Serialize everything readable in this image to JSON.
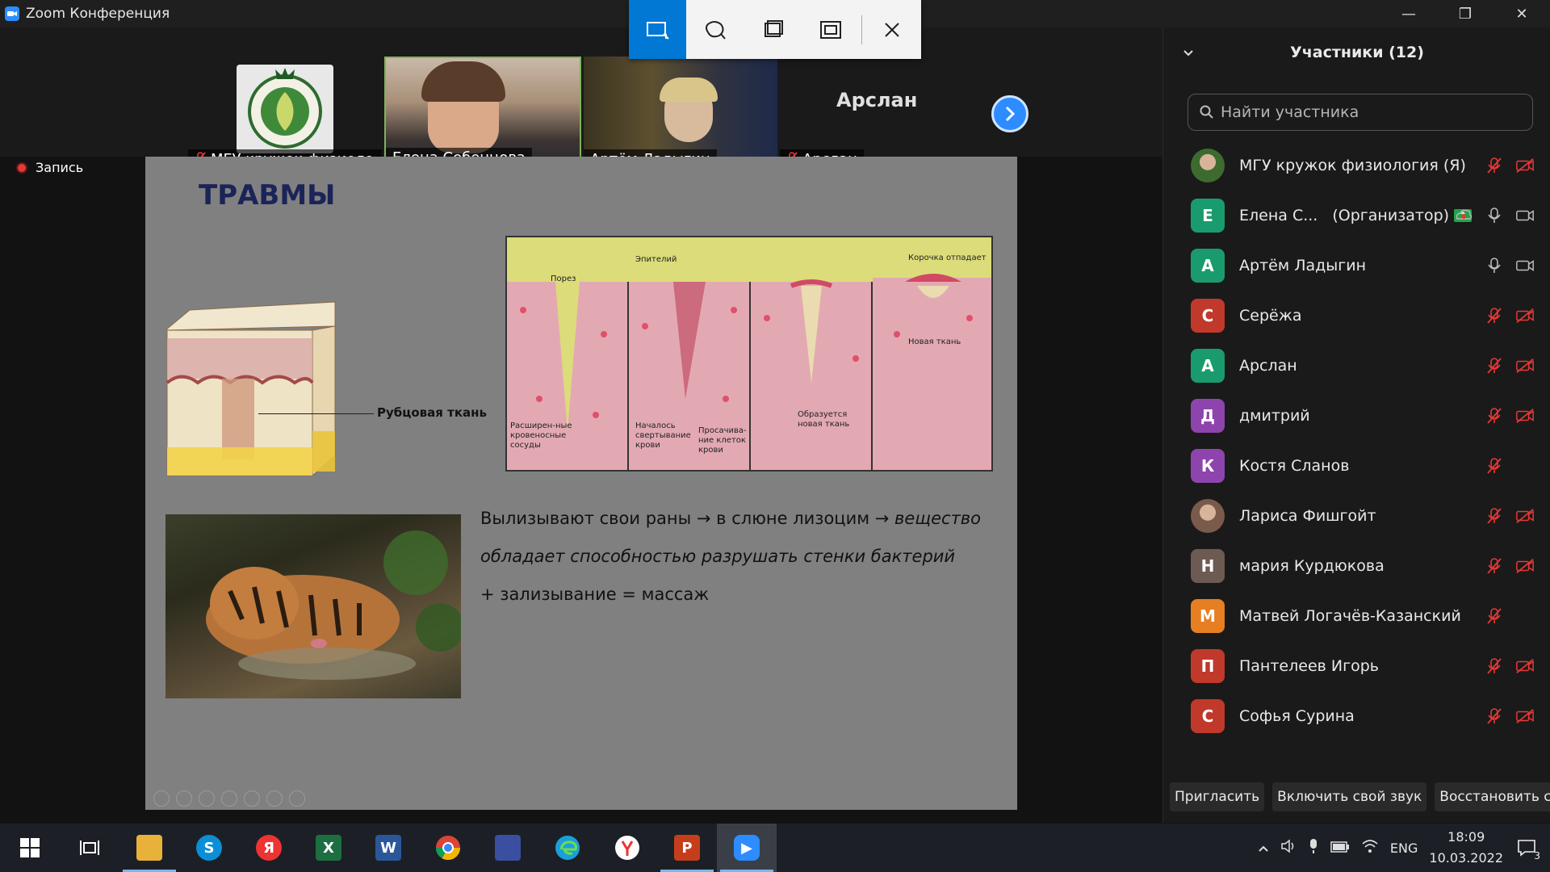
{
  "window": {
    "title": "Zoom Конференция",
    "controls": {
      "minimize": "—",
      "restore": "❐",
      "close": "✕"
    }
  },
  "video_strip": {
    "tiles": [
      {
        "name": "МГУ кружок физиоло...",
        "muted": true
      },
      {
        "name": "Елена Себенцова",
        "muted": false
      },
      {
        "name": "Артём Ладыгин",
        "muted": false
      },
      {
        "name": "Арслан",
        "muted": true,
        "avatar_text": "Арслан"
      }
    ],
    "next_icon": "chevron-right-icon"
  },
  "recording": {
    "label": "Запись"
  },
  "slide": {
    "title": "ТРАВМЫ",
    "skin_label": "Рубцовая ткань",
    "wound_labels": {
      "cut": "Порез",
      "epithelium": "Эпителий",
      "crust": "Корочка отпадает",
      "new_tissue": "Новая ткань",
      "vessels": "Расширен-ные кровеносные сосуды",
      "clotting": "Началось свертывание крови",
      "seep": "Просачива-ние клеток крови",
      "forming": "Образуется новая ткань"
    },
    "text_line1_normal": "Вылизывают свои раны → в слюне лизоцим → ",
    "text_line1_italic": "вещество",
    "text_line2_italic": "обладает способностью разрушать стенки бактерий",
    "text_line3": "+ зализывание = массаж"
  },
  "participants": {
    "header": "Участники (12)",
    "search_placeholder": "Найти участника",
    "list": [
      {
        "initial": "",
        "name": "МГУ кружок физиология (Я)",
        "color": "#3d6b2f",
        "mic": "off",
        "video": "off",
        "photo": true
      },
      {
        "initial": "Е",
        "name": "Елена С...",
        "role": "(Организатор)",
        "color": "#1a9b6e",
        "mic": "on",
        "video": "on",
        "share": true,
        "record": true
      },
      {
        "initial": "А",
        "name": "Артём Ладыгин",
        "color": "#1a9b6e",
        "mic": "on",
        "video": "on"
      },
      {
        "initial": "С",
        "name": "Серёжа",
        "color": "#c0392b",
        "mic": "off",
        "video": "off"
      },
      {
        "initial": "А",
        "name": "Арслан",
        "color": "#1a9b6e",
        "mic": "off",
        "video": "off"
      },
      {
        "initial": "Д",
        "name": "дмитрий",
        "color": "#8e44ad",
        "mic": "off",
        "video": "off"
      },
      {
        "initial": "К",
        "name": "Костя Сланов",
        "color": "#8e44ad",
        "mic": "off",
        "video": "none"
      },
      {
        "initial": "",
        "name": "Лариса Фишгойт",
        "color": "#7a5a4a",
        "mic": "off",
        "video": "off",
        "photo": true
      },
      {
        "initial": "Н",
        "name": "мария Курдюкова",
        "color": "#6d5a52",
        "mic": "off",
        "video": "off"
      },
      {
        "initial": "М",
        "name": "Матвей Логачёв-Казанский",
        "color": "#e67e22",
        "mic": "off",
        "video": "none"
      },
      {
        "initial": "П",
        "name": "Пантелеев Игорь",
        "color": "#c0392b",
        "mic": "off",
        "video": "off"
      },
      {
        "initial": "С",
        "name": "Софья Сурина",
        "color": "#c0392b",
        "mic": "off",
        "video": "off"
      }
    ],
    "footer": {
      "invite": "Пригласить",
      "unmute": "Включить свой звук",
      "restore": "Восстановить статус"
    }
  },
  "taskbar": {
    "lang": "ENG",
    "time": "18:09",
    "date": "10.03.2022",
    "notifications": "3",
    "apps": [
      "start-icon",
      "task-view-icon",
      "file-explorer-icon",
      "skype-icon",
      "yandex-icon",
      "excel-icon",
      "word-icon",
      "chrome-icon",
      "save-icon",
      "edge-icon",
      "yandex-browser-icon",
      "powerpoint-icon",
      "zoom-icon"
    ],
    "app_glyphs": {
      "skype": "S",
      "yandex": "Я",
      "excel": "X",
      "word": "W",
      "powerpoint": "P",
      "zoom": "▶"
    }
  }
}
